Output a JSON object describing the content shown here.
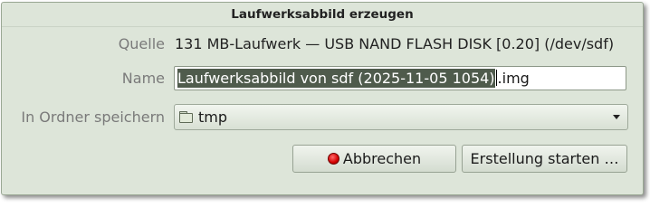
{
  "dialog": {
    "title": "Laufwerksabbild erzeugen"
  },
  "source": {
    "label": "Quelle",
    "value": "131 MB-Laufwerk — USB NAND FLASH DISK [0.20] (/dev/sdf)"
  },
  "name": {
    "label": "Name",
    "selected_text": "Laufwerksabbild von sdf (2025-11-05 1054)",
    "suffix": ".img"
  },
  "folder": {
    "label": "In Ordner speichern",
    "selected": "tmp"
  },
  "buttons": {
    "cancel": "Abbrechen",
    "start": "Erstellung starten …"
  },
  "icons": {
    "folder": "folder-icon",
    "dropdown": "chevron-down-icon",
    "cancel": "stop-icon"
  }
}
